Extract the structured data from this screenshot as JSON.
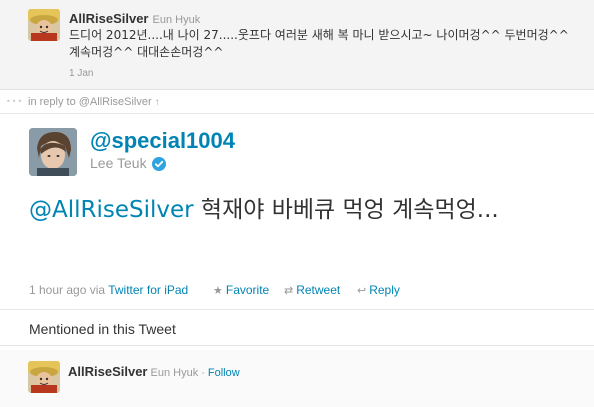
{
  "reply_tweet": {
    "screen_name": "AllRiseSilver",
    "full_name": "Eun Hyuk",
    "text": "드디어 2012년....내 나이 27.....웃프다 여러분 새해 복 마니 받으시고~ 나이머겅^^ 두번머겅^^ 계속머겅^^ 대대손손머겅^^",
    "time": "1 Jan"
  },
  "in_reply_to": {
    "text": "in reply to @AllRiseSilver",
    "arrow": "↑"
  },
  "main_tweet": {
    "screen_name": "@special1004",
    "full_name": "Lee Teuk",
    "verified": true,
    "mention": "@AllRiseSilver",
    "text": " 혁재야 바베큐 먹엉 계속먹엉...",
    "time": "1 hour ago",
    "via_prefix": "via",
    "client": "Twitter for iPad",
    "actions": {
      "favorite": "Favorite",
      "retweet": "Retweet",
      "reply": "Reply"
    }
  },
  "mentioned": {
    "title": "Mentioned in this Tweet",
    "users": [
      {
        "screen_name": "AllRiseSilver",
        "full_name": "Eun Hyuk",
        "separator": "·",
        "follow": "Follow"
      }
    ]
  },
  "colors": {
    "link": "#0084b4",
    "verified": "#2fa3e0",
    "muted": "#999999"
  }
}
